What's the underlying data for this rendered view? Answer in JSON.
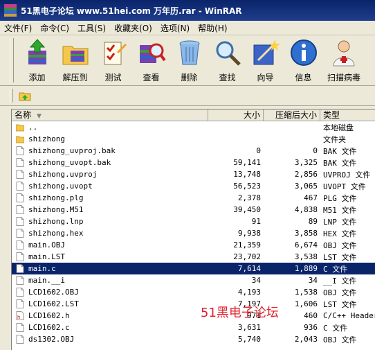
{
  "window": {
    "title": "51黑电子论坛 www.51hei.com 万年历.rar - WinRAR"
  },
  "menu": [
    {
      "label": "文件(F)"
    },
    {
      "label": "命令(C)"
    },
    {
      "label": "工具(S)"
    },
    {
      "label": "收藏夹(O)"
    },
    {
      "label": "选项(N)"
    },
    {
      "label": "帮助(H)"
    }
  ],
  "toolbar": [
    {
      "label": "添加",
      "icon": "add-icon"
    },
    {
      "label": "解压到",
      "icon": "extract-to-icon"
    },
    {
      "label": "测试",
      "icon": "test-icon"
    },
    {
      "label": "查看",
      "icon": "view-icon"
    },
    {
      "label": "删除",
      "icon": "delete-icon"
    },
    {
      "label": "查找",
      "icon": "find-icon"
    },
    {
      "label": "向导",
      "icon": "wizard-icon"
    },
    {
      "label": "信息",
      "icon": "info-icon"
    },
    {
      "label": "扫描病毒",
      "icon": "virus-scan-icon"
    }
  ],
  "columns": {
    "name": "名称",
    "size": "大小",
    "packed": "压缩后大小",
    "type": "类型"
  },
  "files": [
    {
      "name": "..",
      "size": "",
      "packed": "",
      "type": "本地磁盘",
      "icon": "folder-icon"
    },
    {
      "name": "shizhong",
      "size": "",
      "packed": "",
      "type": "文件夹",
      "icon": "folder-icon"
    },
    {
      "name": "shizhong_uvproj.bak",
      "size": "0",
      "packed": "0",
      "type": "BAK 文件",
      "icon": "file-icon"
    },
    {
      "name": "shizhong_uvopt.bak",
      "size": "59,141",
      "packed": "3,325",
      "type": "BAK 文件",
      "icon": "file-icon"
    },
    {
      "name": "shizhong.uvproj",
      "size": "13,748",
      "packed": "2,856",
      "type": "UVPROJ 文件",
      "icon": "file-icon"
    },
    {
      "name": "shizhong.uvopt",
      "size": "56,523",
      "packed": "3,065",
      "type": "UVOPT 文件",
      "icon": "file-icon"
    },
    {
      "name": "shizhong.plg",
      "size": "2,378",
      "packed": "467",
      "type": "PLG 文件",
      "icon": "file-icon"
    },
    {
      "name": "shizhong.M51",
      "size": "39,450",
      "packed": "4,838",
      "type": "M51 文件",
      "icon": "file-icon"
    },
    {
      "name": "shizhong.lnp",
      "size": "91",
      "packed": "89",
      "type": "LNP 文件",
      "icon": "file-icon"
    },
    {
      "name": "shizhong.hex",
      "size": "9,938",
      "packed": "3,858",
      "type": "HEX 文件",
      "icon": "file-icon"
    },
    {
      "name": "main.OBJ",
      "size": "21,359",
      "packed": "6,674",
      "type": "OBJ 文件",
      "icon": "file-icon"
    },
    {
      "name": "main.LST",
      "size": "23,702",
      "packed": "3,538",
      "type": "LST 文件",
      "icon": "file-icon"
    },
    {
      "name": "main.c",
      "size": "7,614",
      "packed": "1,889",
      "type": "C 文件",
      "icon": "file-icon",
      "selected": true
    },
    {
      "name": "main.__i",
      "size": "34",
      "packed": "34",
      "type": "__I 文件",
      "icon": "file-icon"
    },
    {
      "name": "LCD1602.OBJ",
      "size": "4,193",
      "packed": "1,538",
      "type": "OBJ 文件",
      "icon": "file-icon"
    },
    {
      "name": "LCD1602.LST",
      "size": "7,197",
      "packed": "1,606",
      "type": "LST 文件",
      "icon": "file-icon"
    },
    {
      "name": "LCD1602.h",
      "size": "971",
      "packed": "460",
      "type": "C/C++ Header",
      "icon": "header-file-icon"
    },
    {
      "name": "LCD1602.c",
      "size": "3,631",
      "packed": "936",
      "type": "C 文件",
      "icon": "file-icon"
    },
    {
      "name": "ds1302.OBJ",
      "size": "5,740",
      "packed": "2,043",
      "type": "OBJ 文件",
      "icon": "file-icon"
    }
  ],
  "watermark": "51黑电子论坛"
}
